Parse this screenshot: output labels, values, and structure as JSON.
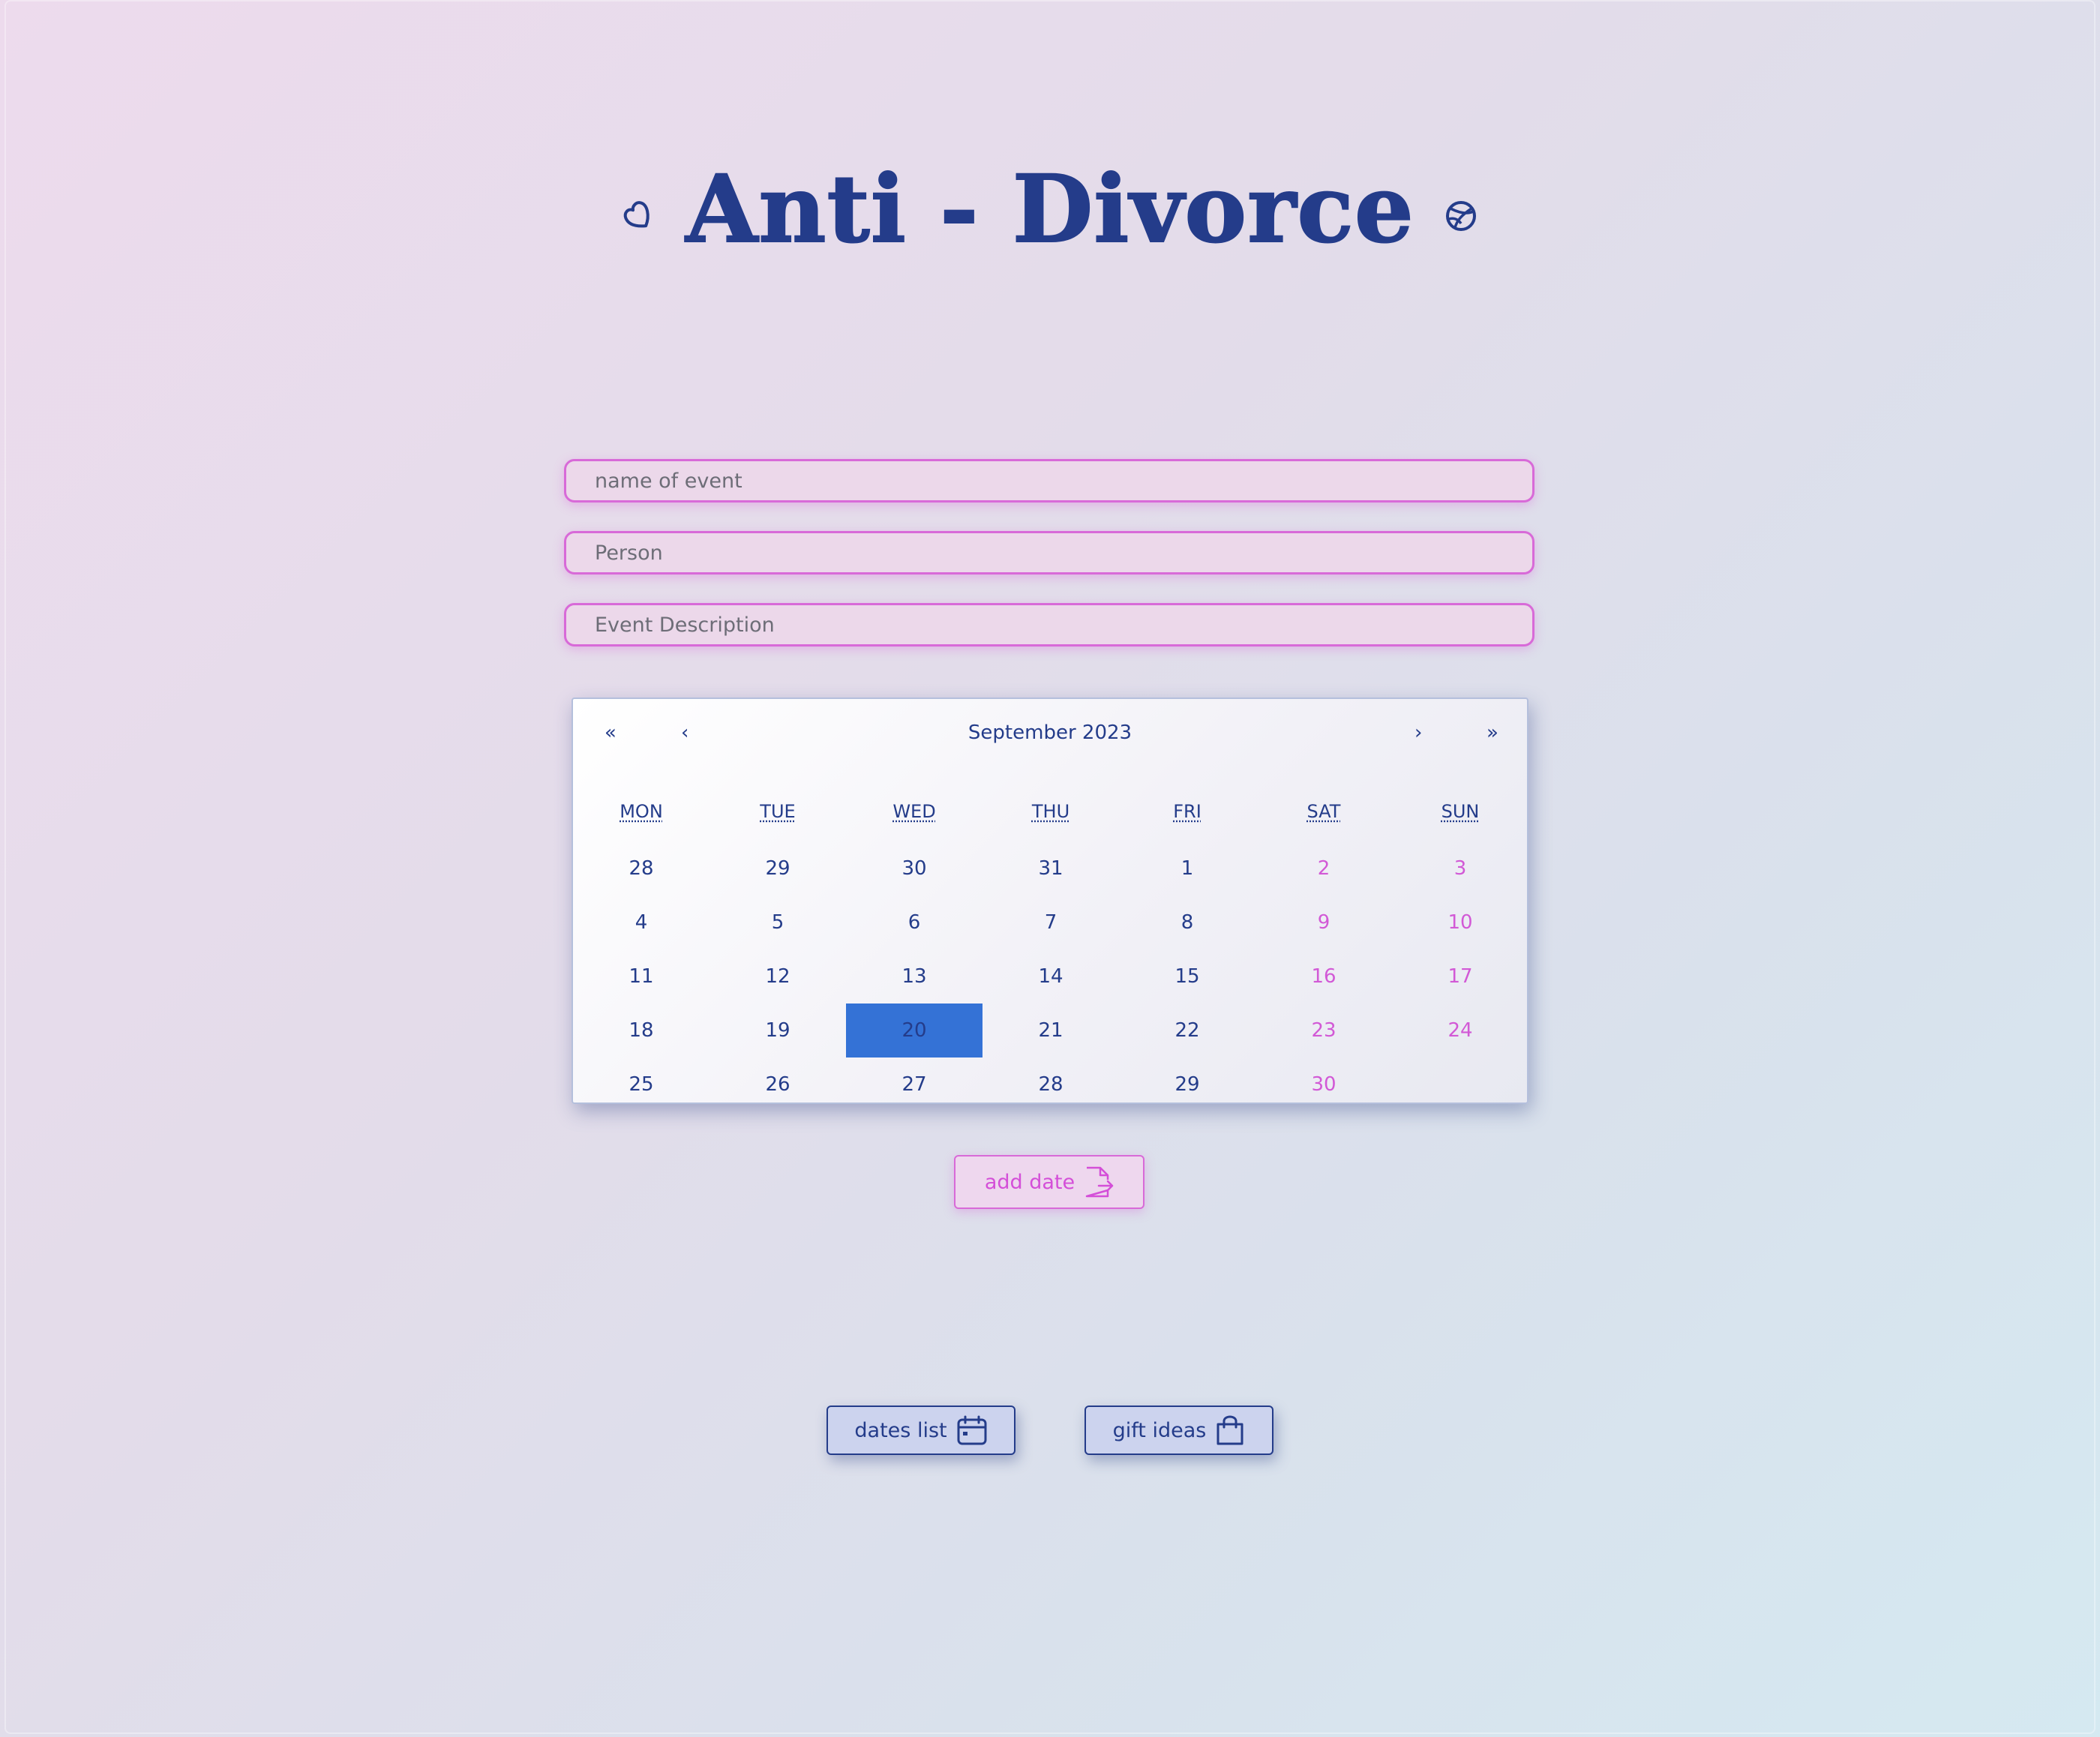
{
  "header": {
    "title": "Anti - Divorce",
    "left_icon": "heart-icon",
    "right_icon": "basketball-icon"
  },
  "form": {
    "event_name_placeholder": "name of event",
    "person_placeholder": "Person",
    "description_placeholder": "Event Description"
  },
  "calendar": {
    "month_label": "September 2023",
    "nav": {
      "prev_year": "«",
      "prev_month": "‹",
      "next_month": "›",
      "next_year": "»"
    },
    "weekdays": [
      "MON",
      "TUE",
      "WED",
      "THU",
      "FRI",
      "SAT",
      "SUN"
    ],
    "weeks": [
      [
        "28",
        "29",
        "30",
        "31",
        "1",
        "2",
        "3"
      ],
      [
        "4",
        "5",
        "6",
        "7",
        "8",
        "9",
        "10"
      ],
      [
        "11",
        "12",
        "13",
        "14",
        "15",
        "16",
        "17"
      ],
      [
        "18",
        "19",
        "20",
        "21",
        "22",
        "23",
        "24"
      ],
      [
        "25",
        "26",
        "27",
        "28",
        "29",
        "30",
        ""
      ]
    ],
    "selected_day": "20",
    "colors": {
      "weekday": "#243c8a",
      "weekend": "#d259d6",
      "selected_bg": "#3472d6"
    }
  },
  "actions": {
    "add_date_label": "add date",
    "add_date_icon": "file-export-icon",
    "dates_list_label": "dates list",
    "dates_list_icon": "calendar-icon",
    "gift_ideas_label": "gift ideas",
    "gift_ideas_icon": "shopping-bag-icon"
  },
  "colors": {
    "primary": "#243c8a",
    "accent": "#d86ad8"
  }
}
